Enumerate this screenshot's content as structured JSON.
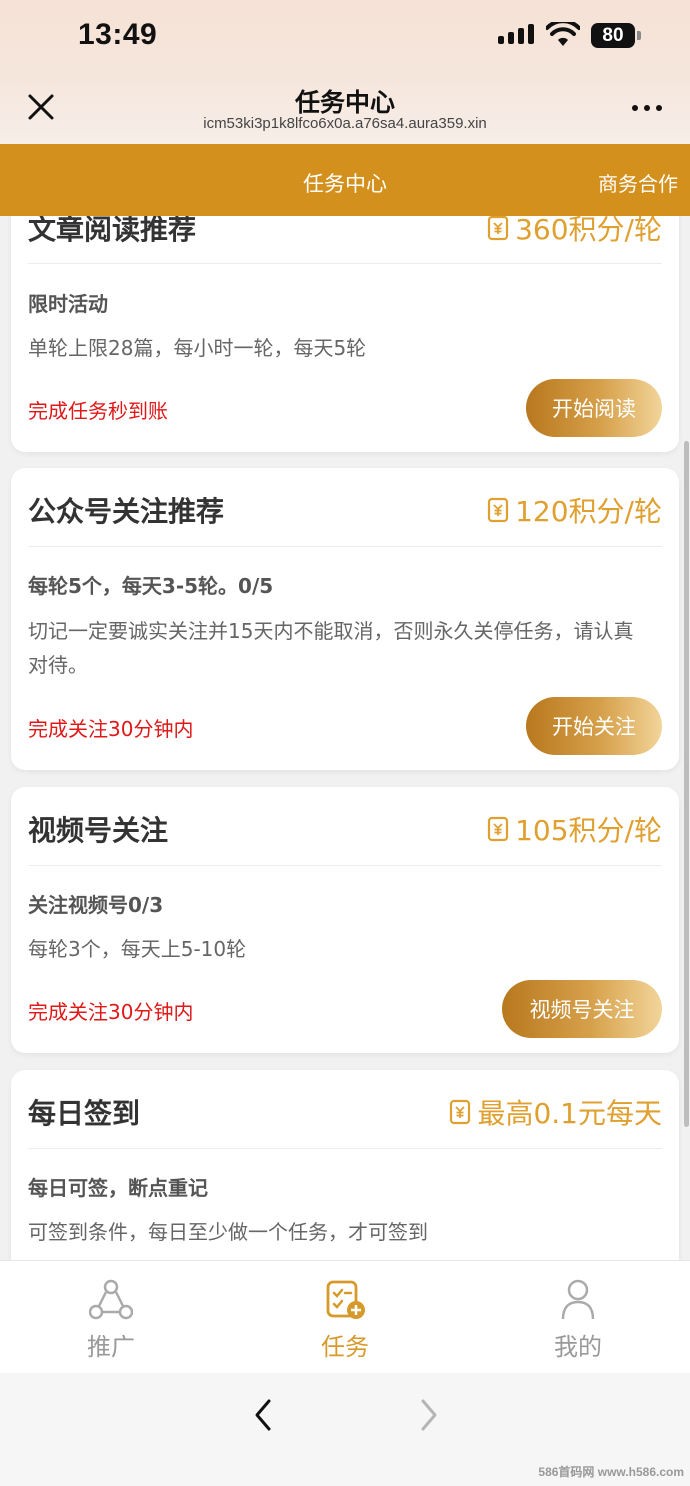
{
  "status_bar": {
    "time": "13:49",
    "battery": "80"
  },
  "browser": {
    "title": "任务中心",
    "url": "icm53ki3p1k8lfco6x0a.a76sa4.aura359.xin"
  },
  "header": {
    "title": "任务中心",
    "biz_link": "商务合作"
  },
  "cards": [
    {
      "title": "文章阅读推荐",
      "points": "360积分/轮",
      "subtitle": "限时活动",
      "desc": "单轮上限28篇，每小时一轮，每天5轮",
      "note": "完成任务秒到账",
      "button": "开始阅读"
    },
    {
      "title": "公众号关注推荐",
      "points": "120积分/轮",
      "subtitle": "每轮5个，每天3-5轮。0/5",
      "desc": "切记一定要诚实关注并15天内不能取消，否则永久关停任务，请认真对待。",
      "note": "完成关注30分钟内",
      "button": "开始关注"
    },
    {
      "title": "视频号关注",
      "points": "105积分/轮",
      "subtitle": "关注视频号0/3",
      "desc": "每轮3个，每天上5-10轮",
      "note": "完成关注30分钟内",
      "button": "视频号关注"
    },
    {
      "title": "每日签到",
      "points": "最高0.1元每天",
      "subtitle": "每日可签，断点重记",
      "desc": "可签到条件，每日至少做一个任务，才可签到"
    }
  ],
  "bottom_nav": [
    {
      "label": "推广",
      "icon": "share-nodes-icon"
    },
    {
      "label": "任务",
      "icon": "task-add-icon",
      "active": true
    },
    {
      "label": "我的",
      "icon": "person-icon"
    }
  ],
  "colors": {
    "accent": "#d3901c",
    "points": "#e0a030",
    "note_red": "#e01818",
    "nav_active": "#d79a2a",
    "nav_inactive": "#999999"
  },
  "watermark": "586首码网 www.h586.com"
}
